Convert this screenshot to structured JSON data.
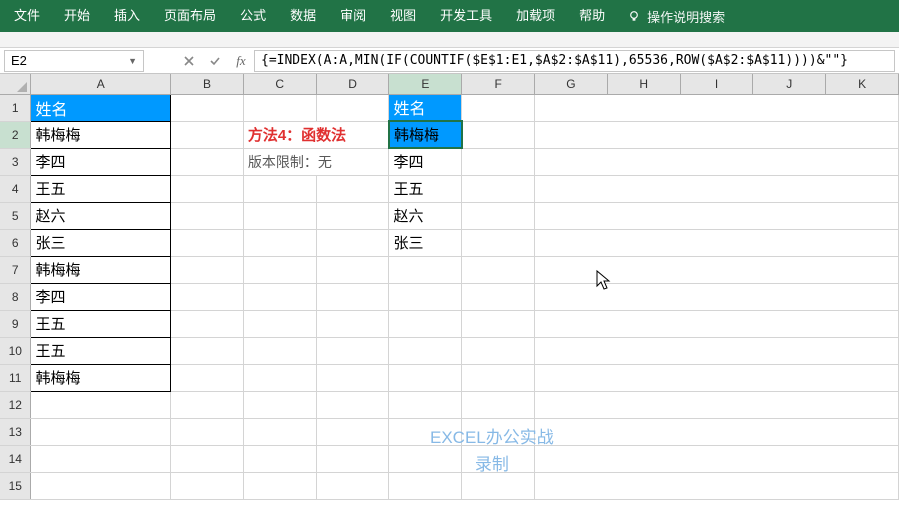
{
  "ribbon": {
    "tabs": [
      "文件",
      "开始",
      "插入",
      "页面布局",
      "公式",
      "数据",
      "审阅",
      "视图",
      "开发工具",
      "加载项",
      "帮助"
    ],
    "hint": "操作说明搜索"
  },
  "formula_bar": {
    "name_box": "E2",
    "formula": "{=INDEX(A:A,MIN(IF(COUNTIF($E$1:E1,$A$2:$A$11),65536,ROW($A$2:$A$11))))&\"\"}"
  },
  "columns": [
    "A",
    "B",
    "C",
    "D",
    "E",
    "F",
    "G",
    "H",
    "I",
    "J",
    "K"
  ],
  "rows": [
    1,
    2,
    3,
    4,
    5,
    6,
    7,
    8,
    9,
    10,
    11,
    12,
    13,
    14,
    15
  ],
  "a_data": [
    "姓名",
    "韩梅梅",
    "李四",
    "王五",
    "赵六",
    "张三",
    "韩梅梅",
    "李四",
    "王五",
    "王五",
    "韩梅梅"
  ],
  "e_data": [
    "姓名",
    "韩梅梅",
    "李四",
    "王五",
    "赵六",
    "张三"
  ],
  "c_text": {
    "method": "方法4：函数法",
    "limit": "版本限制：无"
  },
  "watermark": {
    "line1": "EXCEL办公实战",
    "line2": "录制"
  }
}
